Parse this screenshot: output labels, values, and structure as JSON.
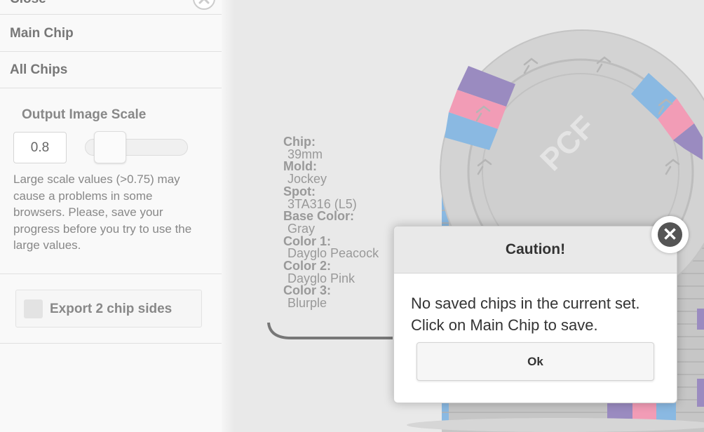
{
  "sidebar": {
    "items": [
      {
        "label": "Close"
      },
      {
        "label": "Main Chip"
      },
      {
        "label": "All Chips"
      }
    ],
    "output_scale": {
      "label": "Output Image Scale",
      "value": "0.8",
      "slider_level": 0.13,
      "warning": "Large scale values (>0.75) may cause a problems in some browsers. Please, save your progress before you try to use the large values."
    },
    "export": {
      "label": "Export 2 chip sides",
      "checked": false
    }
  },
  "chip_info": {
    "chip_key": "Chip:",
    "chip_val": "39mm",
    "mold_key": "Mold:",
    "mold_val": "Jockey",
    "spot_key": "Spot:",
    "spot_val": "3TA316 (L5)",
    "base_key": "Base Color:",
    "base_val": "Gray",
    "c1_key": "Color 1:",
    "c1_val": "Dayglo Peacock",
    "c2_key": "Color 2:",
    "c2_val": "Dayglo Pink",
    "c3_key": "Color 3:",
    "c3_val": "Blurple"
  },
  "chip_colors": {
    "base": "#d1d1d1",
    "peacock": "#8ab9e2",
    "pink": "#f29cb6",
    "blurple": "#9a8bc0"
  },
  "chip_watermark": "PCF",
  "dialog": {
    "title": "Caution!",
    "line1": "No saved chips in the current set.",
    "line2": "Click on Main Chip to save.",
    "ok": "Ok"
  },
  "icons": {
    "panel_close": "close-circle-icon",
    "dialog_close": "close-circle-icon"
  }
}
